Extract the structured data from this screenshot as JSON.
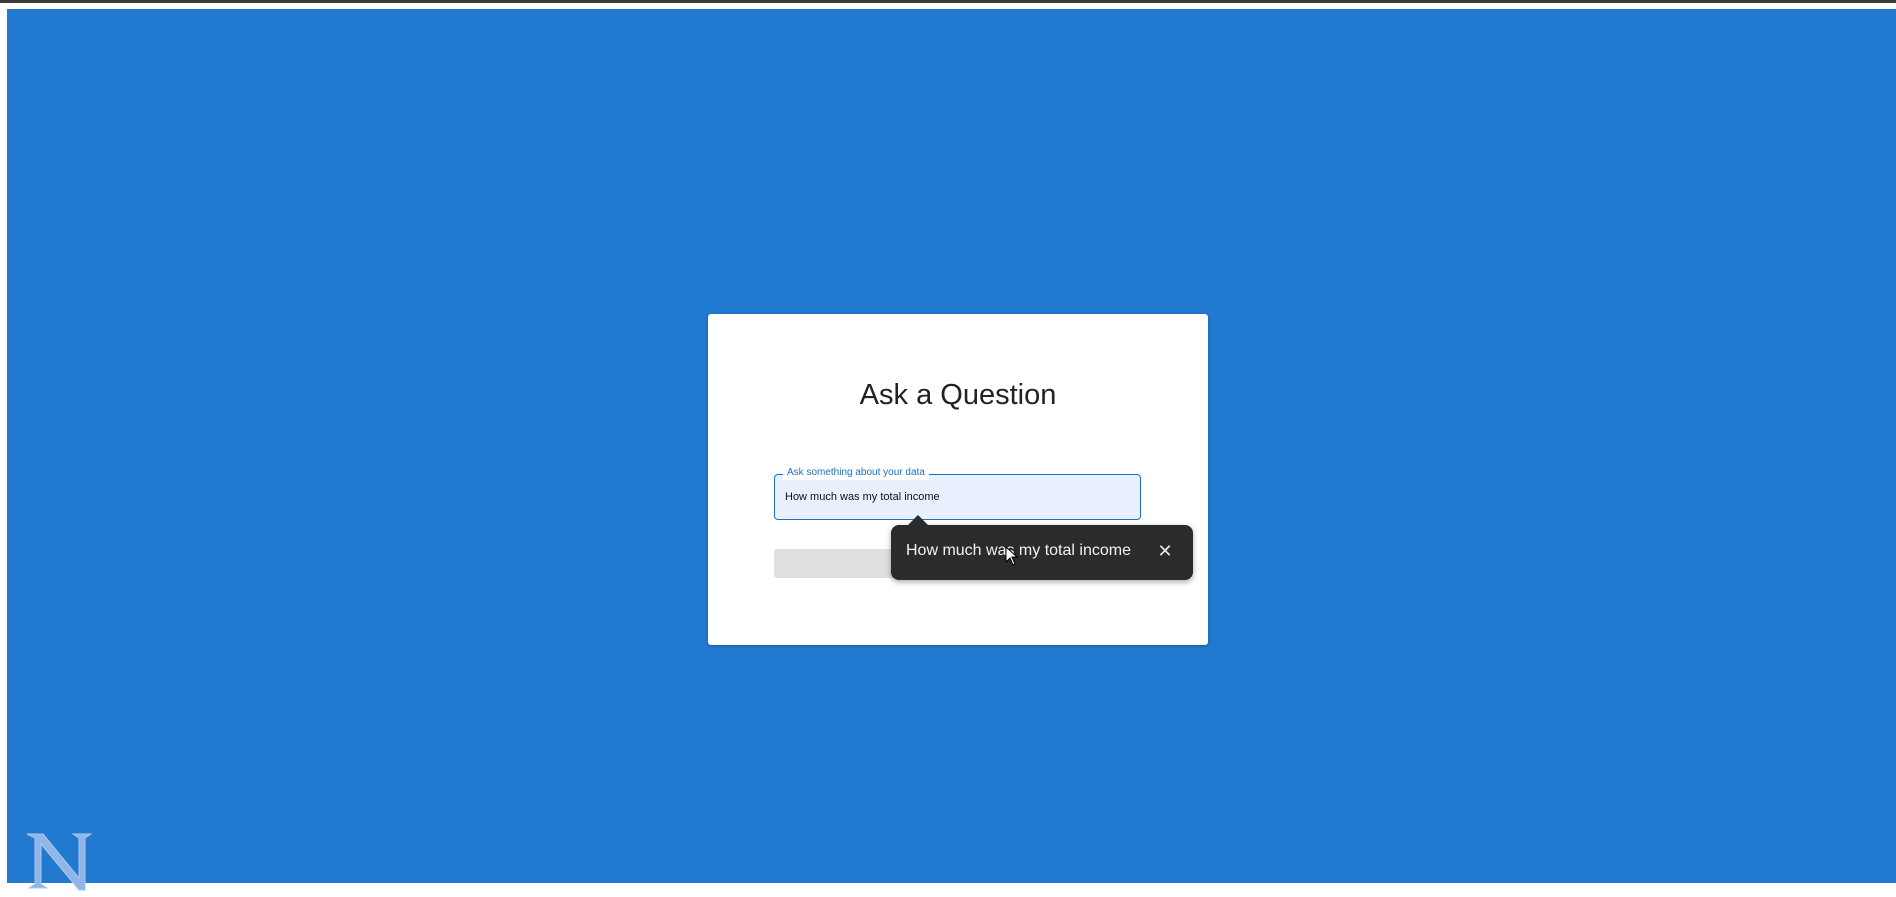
{
  "dialog": {
    "title": "Ask a Question",
    "field_label": "Ask something about your data",
    "field_value": "How much was my total income",
    "submit_label": ""
  },
  "tooltip": {
    "text": "How much was my total income",
    "close_glyph": "✕"
  },
  "icons": {
    "close": "close-icon",
    "logo": "n-logo-icon",
    "cursor": "mouse-pointer-icon"
  },
  "colors": {
    "background": "#2279d0",
    "accent": "#1e6fc0",
    "tooltip_bg": "#2a2b2d",
    "field_bg": "#e8f0fd"
  }
}
